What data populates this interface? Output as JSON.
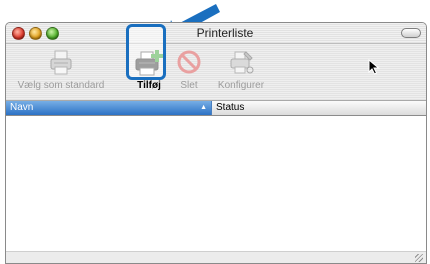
{
  "window": {
    "title": "Printerliste"
  },
  "toolbar": {
    "items": [
      {
        "label": "Vælg som standard",
        "icon": "default-printer-icon",
        "enabled": false
      },
      {
        "label": "Tilføj",
        "icon": "add-printer-icon",
        "enabled": true
      },
      {
        "label": "Slet",
        "icon": "delete-icon",
        "enabled": false
      },
      {
        "label": "Konfigurer",
        "icon": "configure-icon",
        "enabled": false
      }
    ]
  },
  "list": {
    "columns": [
      {
        "label": "Navn",
        "sorted": "ascending"
      },
      {
        "label": "Status"
      }
    ],
    "rows": []
  },
  "colors": {
    "highlight": "#1a6fbf",
    "arrow": "#1a6fbf",
    "header_selected": "#2c72c5"
  }
}
